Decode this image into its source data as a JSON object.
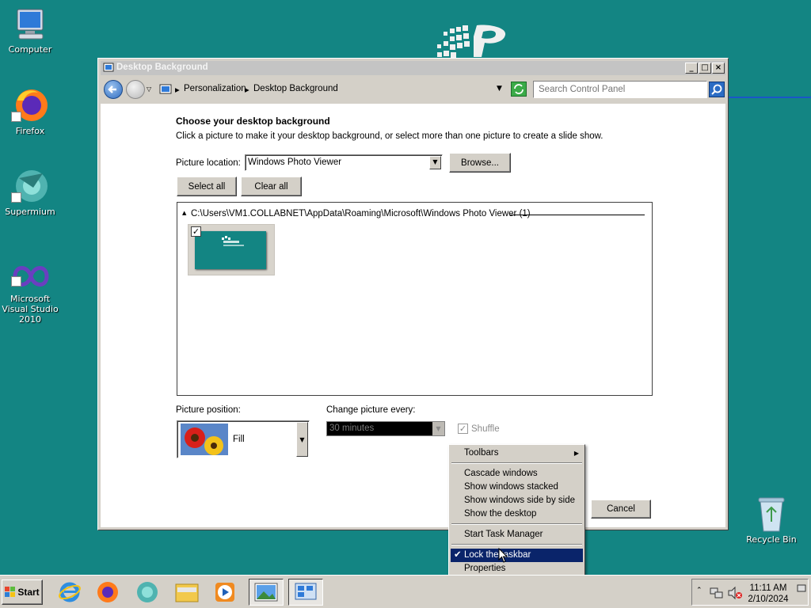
{
  "desktop": {
    "icons": [
      {
        "label": "Computer"
      },
      {
        "label": "Firefox"
      },
      {
        "label": "Supermium"
      },
      {
        "label": "Microsoft Visual Studio 2010"
      },
      {
        "label": "Recycle Bin"
      }
    ]
  },
  "window": {
    "title": "Desktop Background",
    "breadcrumb": [
      "Personalization",
      "Desktop Background"
    ],
    "search_placeholder": "Search Control Panel"
  },
  "content": {
    "heading": "Choose your desktop background",
    "description": "Click a picture to make it your desktop background, or select more than one picture to create a slide show.",
    "picture_location_label": "Picture location:",
    "picture_location_value": "Windows Photo Viewer",
    "browse_label": "Browse...",
    "select_all_label": "Select all",
    "clear_all_label": "Clear all",
    "group_path": "C:\\Users\\VM1.COLLABNET\\AppData\\Roaming\\Microsoft\\Windows Photo Viewer (1)",
    "picture_position_label": "Picture position:",
    "picture_position_value": "Fill",
    "change_picture_label": "Change picture every:",
    "change_picture_value": "30 minutes",
    "shuffle_label": "Shuffle",
    "cancel_label": "Cancel"
  },
  "context_menu": {
    "items": [
      {
        "label": "Toolbars",
        "submenu": true
      },
      {
        "label": "Cascade windows"
      },
      {
        "label": "Show windows stacked"
      },
      {
        "label": "Show windows side by side"
      },
      {
        "label": "Show the desktop"
      },
      {
        "label": "Start Task Manager"
      },
      {
        "label": "Lock the taskbar",
        "checked": true,
        "selected": true
      },
      {
        "label": "Properties"
      }
    ]
  },
  "taskbar": {
    "start_label": "Start",
    "time": "11:11 AM",
    "date": "2/10/2024"
  },
  "colors": {
    "desktop": "#138583",
    "menu_highlight": "#0a246a"
  }
}
